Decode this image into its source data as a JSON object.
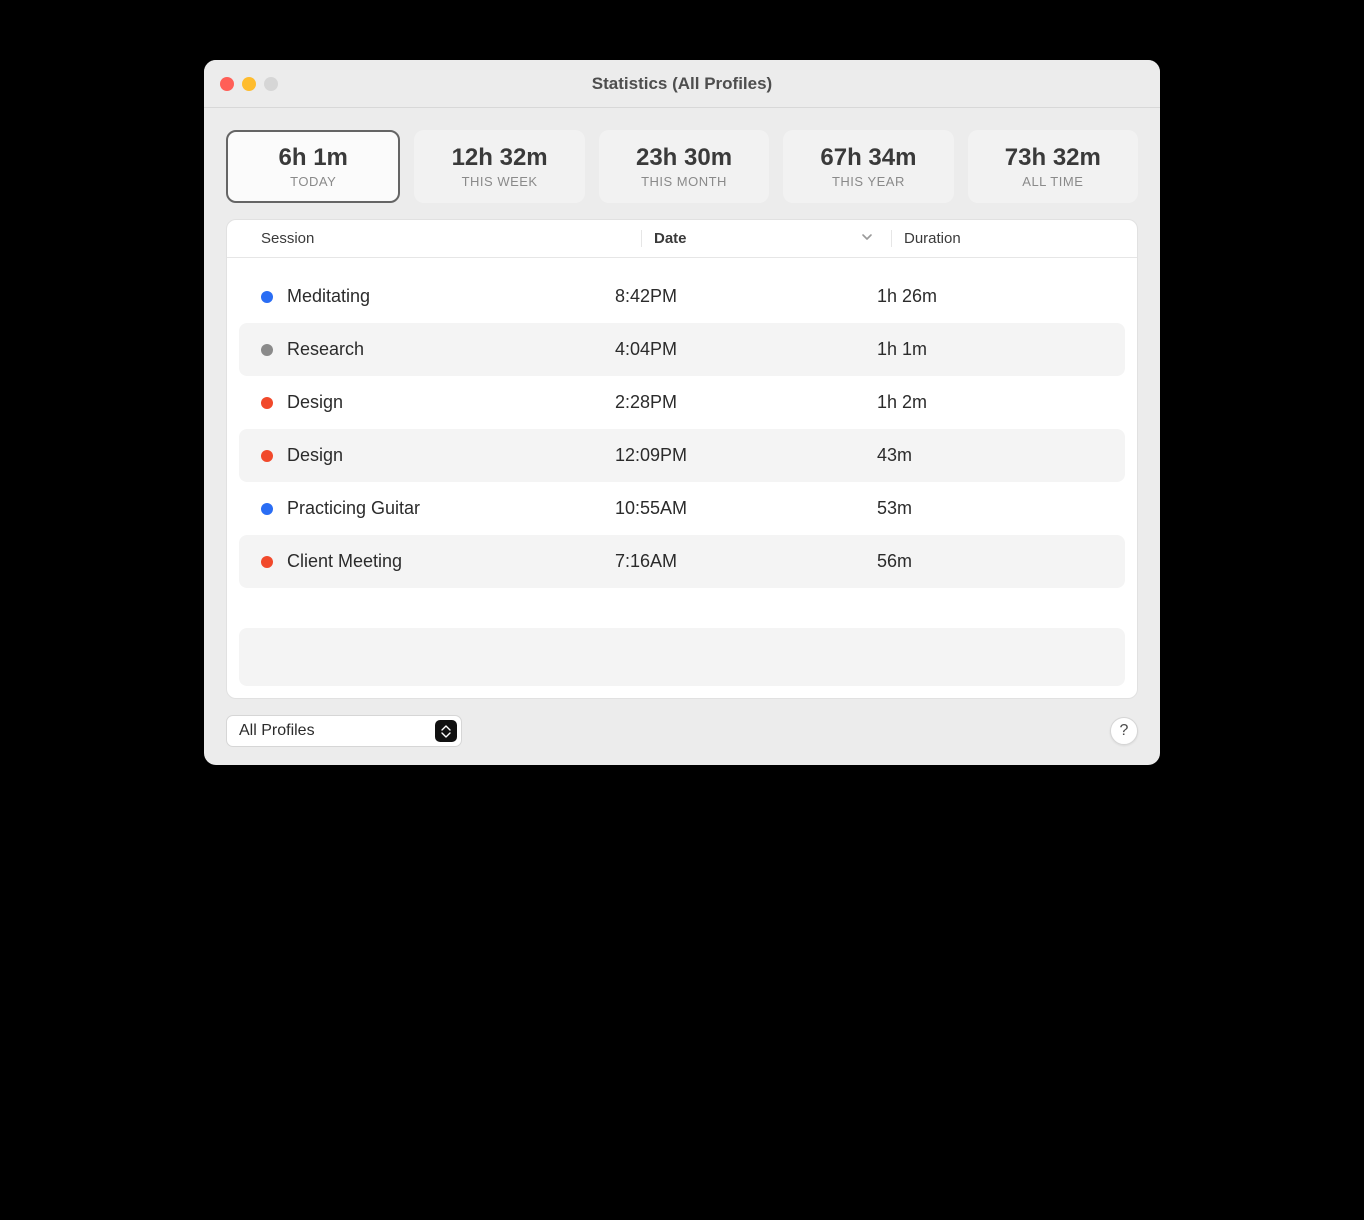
{
  "window": {
    "title": "Statistics (All Profiles)"
  },
  "summary": [
    {
      "value": "6h 1m",
      "label": "TODAY",
      "selected": true
    },
    {
      "value": "12h 32m",
      "label": "THIS WEEK",
      "selected": false
    },
    {
      "value": "23h 30m",
      "label": "THIS MONTH",
      "selected": false
    },
    {
      "value": "67h 34m",
      "label": "THIS YEAR",
      "selected": false
    },
    {
      "value": "73h 32m",
      "label": "ALL TIME",
      "selected": false
    }
  ],
  "table": {
    "headers": {
      "session": "Session",
      "date": "Date",
      "duration": "Duration"
    },
    "sort_column": "date",
    "sort_dir": "desc",
    "rows": [
      {
        "color": "#2a6df4",
        "session": "Meditating",
        "date": "8:42PM",
        "duration": "1h 26m"
      },
      {
        "color": "#8a8a8a",
        "session": "Research",
        "date": "4:04PM",
        "duration": "1h 1m"
      },
      {
        "color": "#f1492b",
        "session": "Design",
        "date": "2:28PM",
        "duration": "1h 2m"
      },
      {
        "color": "#f1492b",
        "session": "Design",
        "date": "12:09PM",
        "duration": "43m"
      },
      {
        "color": "#2a6df4",
        "session": "Practicing Guitar",
        "date": "10:55AM",
        "duration": "53m"
      },
      {
        "color": "#f1492b",
        "session": "Client Meeting",
        "date": "7:16AM",
        "duration": "56m"
      }
    ]
  },
  "footer": {
    "profile_select": "All Profiles",
    "help": "?"
  }
}
